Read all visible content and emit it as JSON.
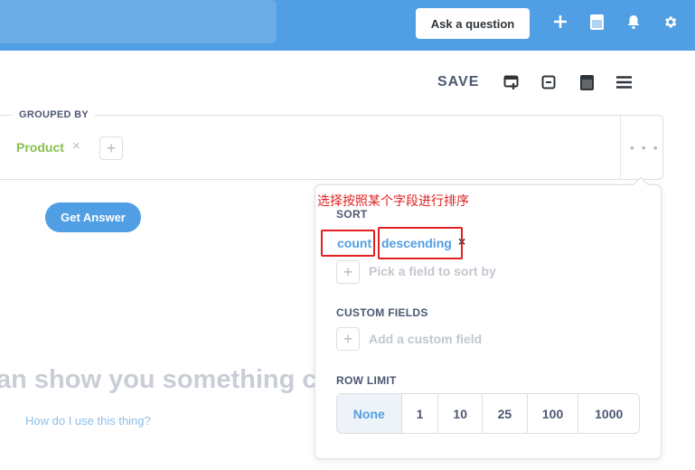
{
  "nav": {
    "ask_label": "Ask a question",
    "icons": [
      "plus-icon",
      "notebook-icon",
      "bell-icon",
      "gear-icon"
    ]
  },
  "toolbar": {
    "save_label": "SAVE",
    "icons": [
      "add-to-dashboard-icon",
      "sharing-icon",
      "notebook-icon",
      "menu-icon"
    ]
  },
  "grouped_by": {
    "label": "GROUPED BY",
    "field": "Product",
    "remove_symbol": "×",
    "add_symbol": "+",
    "more_symbol": "• • •"
  },
  "main": {
    "get_answer_label": "Get Answer",
    "big_text": "an show you something c",
    "help_link": "How do I use this thing?"
  },
  "popover": {
    "annotation": "选择按照某个字段进行排序",
    "sort": {
      "label": "SORT",
      "field": "count",
      "direction": "descending",
      "remove_symbol": "×",
      "pick_placeholder": "Pick a field to sort by"
    },
    "custom_fields": {
      "label": "CUSTOM FIELDS",
      "add_text": "Add a custom field"
    },
    "row_limit": {
      "label": "ROW LIMIT",
      "options": [
        "None",
        "1",
        "10",
        "25",
        "100",
        "1000"
      ],
      "selected": "None"
    }
  },
  "colors": {
    "brand": "#509ee3",
    "dimension_green": "#88bf4d",
    "annotation_red": "#e02020"
  }
}
